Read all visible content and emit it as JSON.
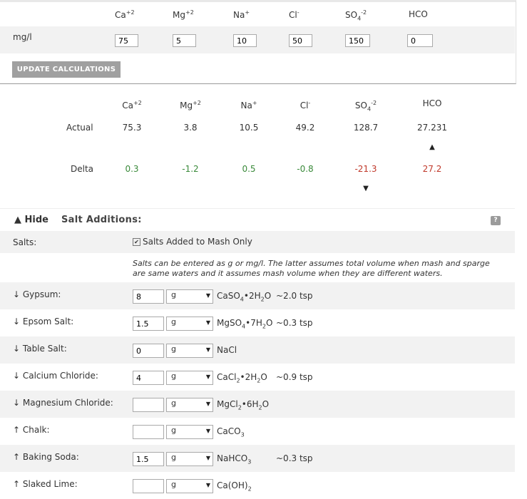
{
  "target": {
    "headers": [
      "Ca",
      "Mg",
      "Na",
      "Cl",
      "SO",
      "HCO"
    ],
    "header_sups": [
      "+2",
      "+2",
      "+",
      "-",
      "-2",
      ""
    ],
    "so4_sub": "4",
    "row_label": "mg/l",
    "values": [
      "75",
      "5",
      "10",
      "50",
      "150",
      "0"
    ],
    "update_label": "UPDATE CALCULATIONS"
  },
  "results": {
    "headers": [
      "Ca",
      "Mg",
      "Na",
      "Cl",
      "SO",
      "HCO"
    ],
    "header_sups": [
      "+2",
      "+2",
      "+",
      "-",
      "-2",
      ""
    ],
    "so4_sub": "4",
    "actual_label": "Actual",
    "actual": [
      "75.3",
      "3.8",
      "10.5",
      "49.2",
      "128.7",
      "27.231"
    ],
    "delta_label": "Delta",
    "delta": [
      "0.3",
      "-1.2",
      "0.5",
      "-0.8",
      "-21.3",
      "27.2"
    ],
    "up_arrow": "▲",
    "down_arrow": "▼"
  },
  "salt": {
    "toggle_label": "▲ Hide",
    "title": "Salt Additions:",
    "help": "?",
    "salts_label": "Salts:",
    "mash_only_label": "Salts Added to Mash Only",
    "note": "Salts can be entered as g or mg/l. The latter assumes total volume when mash and sparge are same waters and it assumes mash volume when they are different waters.",
    "rows": [
      {
        "label": "↓ Gypsum:",
        "amount": "8",
        "unit": "g",
        "formula": "CaSO",
        "f_sub": "4",
        "f_rest": "•2H",
        "f_sub2": "2",
        "f_tail": "O",
        "tsp": "~2.0 tsp"
      },
      {
        "label": "↓ Epsom Salt:",
        "amount": "1.5",
        "unit": "g",
        "formula": "MgSO",
        "f_sub": "4",
        "f_rest": "•7H",
        "f_sub2": "2",
        "f_tail": "O",
        "tsp": "~0.3 tsp"
      },
      {
        "label": "↓ Table Salt:",
        "amount": "0",
        "unit": "g",
        "formula": "NaCl",
        "f_sub": "",
        "f_rest": "",
        "f_sub2": "",
        "f_tail": "",
        "tsp": ""
      },
      {
        "label": "↓ Calcium Chloride:",
        "amount": "4",
        "unit": "g",
        "formula": "CaCl",
        "f_sub": "2",
        "f_rest": "•2H",
        "f_sub2": "2",
        "f_tail": "O",
        "tsp": "~0.9 tsp"
      },
      {
        "label": "↓ Magnesium Chloride:",
        "amount": "",
        "unit": "g",
        "formula": "MgCl",
        "f_sub": "2",
        "f_rest": "•6H",
        "f_sub2": "2",
        "f_tail": "O",
        "tsp": ""
      },
      {
        "label": "↑ Chalk:",
        "amount": "",
        "unit": "g",
        "formula": "CaCO",
        "f_sub": "3",
        "f_rest": "",
        "f_sub2": "",
        "f_tail": "",
        "tsp": ""
      },
      {
        "label": "↑ Baking Soda:",
        "amount": "1.5",
        "unit": "g",
        "formula": "NaHCO",
        "f_sub": "3",
        "f_rest": "",
        "f_sub2": "",
        "f_tail": "",
        "tsp": "~0.3 tsp"
      },
      {
        "label": "↑ Slaked Lime:",
        "amount": "",
        "unit": "g",
        "formula": "Ca(OH)",
        "f_sub": "2",
        "f_rest": "",
        "f_sub2": "",
        "f_tail": "",
        "tsp": ""
      }
    ]
  },
  "colors": {
    "positive": "#3a8a3a",
    "negative": "#c0392b",
    "button": "#a0a0a0"
  }
}
